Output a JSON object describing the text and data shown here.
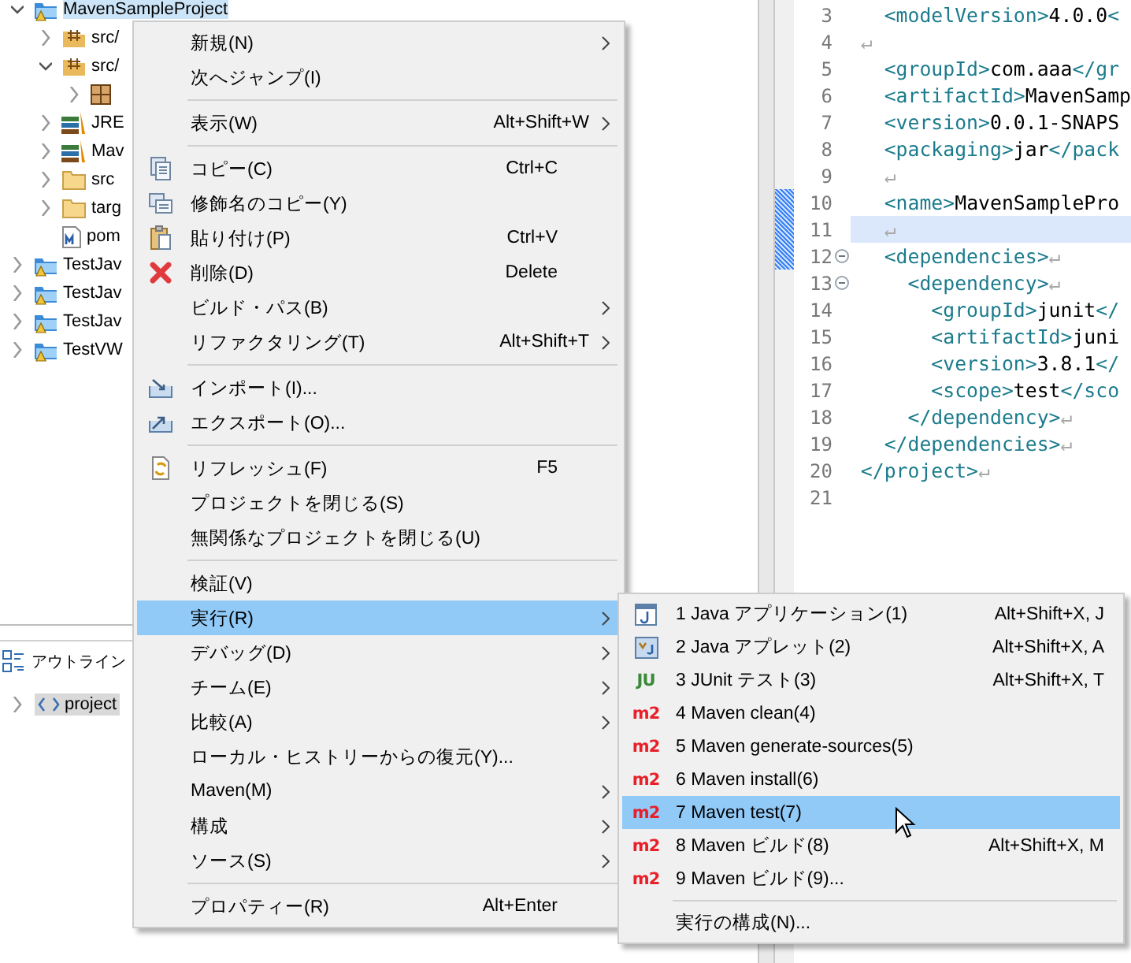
{
  "project_explorer": {
    "items": [
      {
        "label": "MavenSampleProject",
        "kind": "project",
        "expanded": true,
        "selected": true,
        "children": [
          {
            "label": "src/",
            "kind": "source-folder",
            "expanded": false,
            "selected": false
          },
          {
            "label": "src/",
            "kind": "source-folder",
            "expanded": true,
            "selected": false,
            "children": [
              {
                "kind": "package",
                "expanded": false
              }
            ]
          },
          {
            "label": "JRE",
            "kind": "library",
            "expanded": false,
            "selected": false
          },
          {
            "label": "Mav",
            "kind": "library",
            "expanded": false,
            "selected": false
          },
          {
            "label": "src",
            "kind": "folder",
            "expanded": false,
            "selected": false
          },
          {
            "label": "targ",
            "kind": "folder",
            "expanded": false,
            "selected": false
          },
          {
            "label": "pom",
            "kind": "pom-file",
            "selected": false
          }
        ]
      },
      {
        "label": "TestJav",
        "kind": "project",
        "expanded": false,
        "selected": false
      },
      {
        "label": "TestJav",
        "kind": "project",
        "expanded": false,
        "selected": false
      },
      {
        "label": "TestJav",
        "kind": "project",
        "expanded": false,
        "selected": false
      },
      {
        "label": "TestVW",
        "kind": "project",
        "expanded": false,
        "selected": false
      }
    ]
  },
  "outline": {
    "title": "アウトライン",
    "items": [
      {
        "label": "project",
        "expanded": false,
        "selected": true
      }
    ]
  },
  "editor": {
    "lines": [
      {
        "number": "3",
        "current": false,
        "marked": false,
        "foldable": false,
        "tokens": [
          {
            "kind": "tag",
            "text": "  <modelVersion>"
          },
          {
            "kind": "text",
            "text": "4.0.0"
          },
          {
            "kind": "tag",
            "text": "<"
          }
        ]
      },
      {
        "number": "4",
        "current": false,
        "marked": false,
        "foldable": false,
        "tokens": [
          {
            "kind": "eol",
            "text": "↵"
          }
        ]
      },
      {
        "number": "5",
        "current": false,
        "marked": false,
        "foldable": false,
        "tokens": [
          {
            "kind": "tag",
            "text": "  <groupId>"
          },
          {
            "kind": "text",
            "text": "com.aaa"
          },
          {
            "kind": "tag",
            "text": "</gr"
          }
        ]
      },
      {
        "number": "6",
        "current": false,
        "marked": false,
        "foldable": false,
        "tokens": [
          {
            "kind": "tag",
            "text": "  <artifactId>"
          },
          {
            "kind": "text",
            "text": "MavenSamp"
          }
        ]
      },
      {
        "number": "7",
        "current": false,
        "marked": false,
        "foldable": false,
        "tokens": [
          {
            "kind": "tag",
            "text": "  <version>"
          },
          {
            "kind": "text",
            "text": "0.0.1-SNAPS"
          }
        ]
      },
      {
        "number": "8",
        "current": false,
        "marked": false,
        "foldable": false,
        "tokens": [
          {
            "kind": "tag",
            "text": "  <packaging>"
          },
          {
            "kind": "text",
            "text": "jar"
          },
          {
            "kind": "tag",
            "text": "</pack"
          }
        ]
      },
      {
        "number": "9",
        "current": false,
        "marked": false,
        "foldable": false,
        "tokens": [
          {
            "kind": "eol",
            "text": "  ↵"
          }
        ]
      },
      {
        "number": "10",
        "current": false,
        "marked": true,
        "foldable": false,
        "tokens": [
          {
            "kind": "tag",
            "text": "  <name>"
          },
          {
            "kind": "text",
            "text": "MavenSamplePro"
          }
        ]
      },
      {
        "number": "11",
        "current": true,
        "marked": true,
        "foldable": false,
        "tokens": [
          {
            "kind": "eol",
            "text": "  ↵"
          }
        ]
      },
      {
        "number": "12",
        "current": false,
        "marked": true,
        "foldable": true,
        "tokens": [
          {
            "kind": "tag",
            "text": "  <dependencies>"
          },
          {
            "kind": "eol",
            "text": "↵"
          }
        ]
      },
      {
        "number": "13",
        "current": false,
        "marked": false,
        "foldable": true,
        "tokens": [
          {
            "kind": "tag",
            "text": "    <dependency>"
          },
          {
            "kind": "eol",
            "text": "↵"
          }
        ]
      },
      {
        "number": "14",
        "current": false,
        "marked": false,
        "foldable": false,
        "tokens": [
          {
            "kind": "tag",
            "text": "      <groupId>"
          },
          {
            "kind": "text",
            "text": "junit"
          },
          {
            "kind": "tag",
            "text": "</"
          }
        ]
      },
      {
        "number": "15",
        "current": false,
        "marked": false,
        "foldable": false,
        "tokens": [
          {
            "kind": "tag",
            "text": "      <artifactId>"
          },
          {
            "kind": "text",
            "text": "juni"
          }
        ]
      },
      {
        "number": "16",
        "current": false,
        "marked": false,
        "foldable": false,
        "tokens": [
          {
            "kind": "tag",
            "text": "      <version>"
          },
          {
            "kind": "text",
            "text": "3.8.1"
          },
          {
            "kind": "tag",
            "text": "</"
          }
        ]
      },
      {
        "number": "17",
        "current": false,
        "marked": false,
        "foldable": false,
        "tokens": [
          {
            "kind": "tag",
            "text": "      <scope>"
          },
          {
            "kind": "text",
            "text": "test"
          },
          {
            "kind": "tag",
            "text": "</sco"
          }
        ]
      },
      {
        "number": "18",
        "current": false,
        "marked": false,
        "foldable": false,
        "tokens": [
          {
            "kind": "tag",
            "text": "    </dependency>"
          },
          {
            "kind": "eol",
            "text": "↵"
          }
        ]
      },
      {
        "number": "19",
        "current": false,
        "marked": false,
        "foldable": false,
        "tokens": [
          {
            "kind": "tag",
            "text": "  </dependencies>"
          },
          {
            "kind": "eol",
            "text": "↵"
          }
        ]
      },
      {
        "number": "20",
        "current": false,
        "marked": false,
        "foldable": false,
        "tokens": [
          {
            "kind": "tag",
            "text": "</project>"
          },
          {
            "kind": "eol",
            "text": "↵"
          }
        ]
      },
      {
        "number": "21",
        "current": false,
        "marked": false,
        "foldable": false
      }
    ]
  },
  "context_menu": {
    "items": [
      {
        "kind": "plain",
        "label": "新規(N)",
        "submenu": true,
        "selected": false
      },
      {
        "kind": "plain",
        "label": "次へジャンプ(I)",
        "submenu": false,
        "selected": false
      },
      {
        "kind": "separator"
      },
      {
        "kind": "plain",
        "label": "表示(W)",
        "shortcut": "Alt+Shift+W",
        "submenu": true,
        "selected": false
      },
      {
        "kind": "separator"
      },
      {
        "kind": "copy",
        "label": "コピー(C)",
        "shortcut": "Ctrl+C",
        "submenu": false,
        "selected": false
      },
      {
        "kind": "qualified-copy",
        "label": "修飾名のコピー(Y)",
        "submenu": false,
        "selected": false
      },
      {
        "kind": "paste",
        "label": "貼り付け(P)",
        "shortcut": "Ctrl+V",
        "submenu": false,
        "selected": false
      },
      {
        "kind": "delete",
        "label": "削除(D)",
        "shortcut": "Delete",
        "submenu": false,
        "selected": false
      },
      {
        "kind": "plain",
        "label": "ビルド・パス(B)",
        "submenu": true,
        "selected": false
      },
      {
        "kind": "plain",
        "label": "リファクタリング(T)",
        "shortcut": "Alt+Shift+T",
        "submenu": true,
        "selected": false
      },
      {
        "kind": "separator"
      },
      {
        "kind": "import",
        "label": "インポート(I)...",
        "submenu": false,
        "selected": false
      },
      {
        "kind": "export",
        "label": "エクスポート(O)...",
        "submenu": false,
        "selected": false
      },
      {
        "kind": "separator"
      },
      {
        "kind": "refresh",
        "label": "リフレッシュ(F)",
        "shortcut": "F5",
        "submenu": false,
        "selected": false
      },
      {
        "kind": "plain",
        "label": "プロジェクトを閉じる(S)",
        "submenu": false,
        "selected": false
      },
      {
        "kind": "plain",
        "label": "無関係なプロジェクトを閉じる(U)",
        "submenu": false,
        "selected": false
      },
      {
        "kind": "separator"
      },
      {
        "kind": "plain",
        "label": "検証(V)",
        "submenu": false,
        "selected": false
      },
      {
        "kind": "plain",
        "label": "実行(R)",
        "submenu": true,
        "selected": true
      },
      {
        "kind": "plain",
        "label": "デバッグ(D)",
        "submenu": true,
        "selected": false
      },
      {
        "kind": "plain",
        "label": "チーム(E)",
        "submenu": true,
        "selected": false
      },
      {
        "kind": "plain",
        "label": "比較(A)",
        "submenu": true,
        "selected": false
      },
      {
        "kind": "plain",
        "label": "ローカル・ヒストリーからの復元(Y)...",
        "submenu": false,
        "selected": false
      },
      {
        "kind": "plain",
        "label": "Maven(M)",
        "submenu": true,
        "selected": false
      },
      {
        "kind": "plain",
        "label": "構成",
        "submenu": true,
        "selected": false
      },
      {
        "kind": "plain",
        "label": "ソース(S)",
        "submenu": true,
        "selected": false
      },
      {
        "kind": "separator"
      },
      {
        "kind": "plain",
        "label": "プロパティー(R)",
        "shortcut": "Alt+Enter",
        "submenu": false,
        "selected": false
      }
    ]
  },
  "run_submenu": {
    "items": [
      {
        "kind": "java-app",
        "label": "1 Java アプリケーション(1)",
        "shortcut": "Alt+Shift+X, J",
        "selected": false
      },
      {
        "kind": "applet",
        "label": "2 Java アプレット(2)",
        "shortcut": "Alt+Shift+X, A",
        "selected": false
      },
      {
        "kind": "junit",
        "badge": "JU",
        "label": "3 JUnit テスト(3)",
        "shortcut": "Alt+Shift+X, T",
        "selected": false
      },
      {
        "kind": "maven",
        "badge": "m2",
        "label": "4 Maven clean(4)",
        "selected": false
      },
      {
        "kind": "maven",
        "badge": "m2",
        "label": "5 Maven generate-sources(5)",
        "selected": false
      },
      {
        "kind": "maven",
        "badge": "m2",
        "label": "6 Maven install(6)",
        "selected": false
      },
      {
        "kind": "maven",
        "badge": "m2",
        "label": "7 Maven test(7)",
        "selected": true
      },
      {
        "kind": "maven",
        "badge": "m2",
        "label": "8 Maven ビルド(8)",
        "shortcut": "Alt+Shift+X, M",
        "selected": false
      },
      {
        "kind": "maven",
        "badge": "m2",
        "label": "9 Maven ビルド(9)...",
        "selected": false
      },
      {
        "kind": "separator"
      },
      {
        "kind": "plain",
        "label": "実行の構成(N)...",
        "selected": false
      }
    ]
  }
}
